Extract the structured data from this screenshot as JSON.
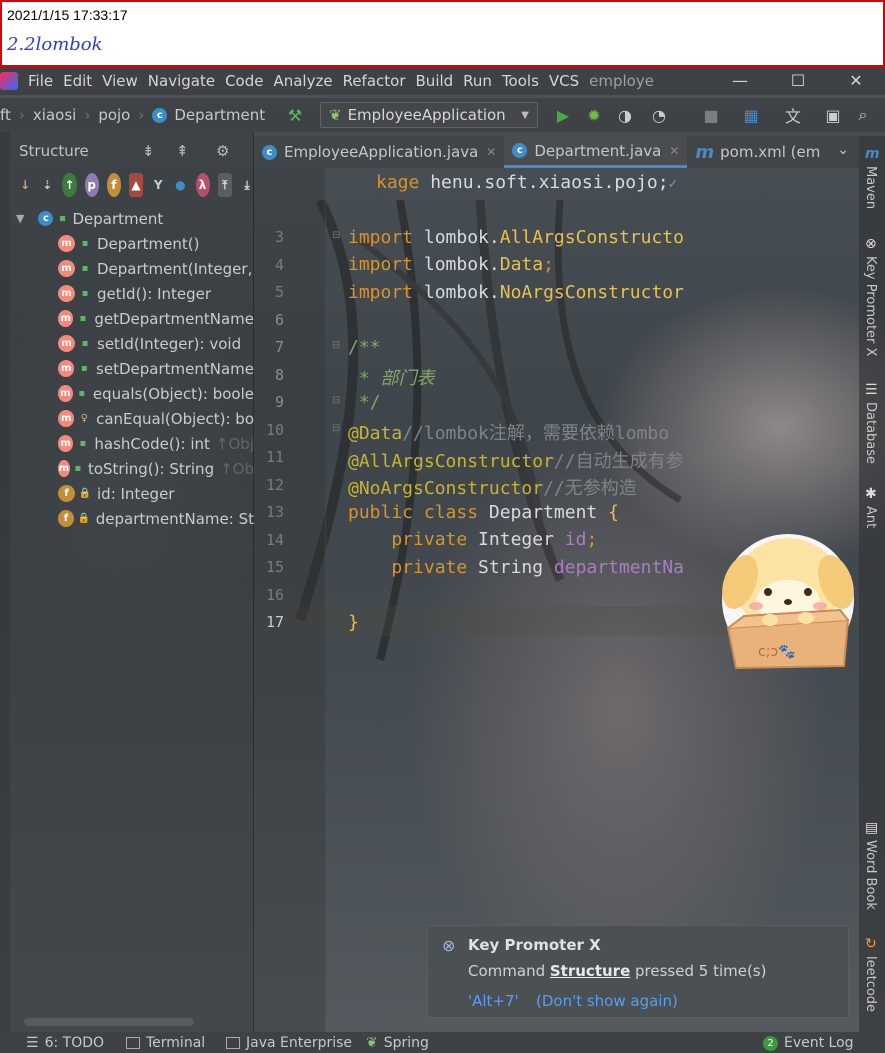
{
  "annotation": {
    "timestamp": "2021/1/15 17:33:17",
    "note_title": "2.2lombok"
  },
  "menu": {
    "items": [
      "File",
      "Edit",
      "View",
      "Navigate",
      "Code",
      "Analyze",
      "Refactor",
      "Build",
      "Run",
      "Tools",
      "VCS"
    ],
    "project_name": "employe",
    "window_buttons": [
      "—",
      "☐",
      "✕"
    ]
  },
  "breadcrumb": {
    "items": [
      "ft",
      "xiaosi",
      "pojo",
      "Department"
    ]
  },
  "run_config": {
    "label": "EmployeeApplication"
  },
  "structure": {
    "title": "Structure",
    "root": "Department",
    "members": [
      {
        "kind": "m",
        "vis": "pub",
        "label": "Department()",
        "hint": ""
      },
      {
        "kind": "m",
        "vis": "pub",
        "label": "Department(Integer,",
        "hint": ""
      },
      {
        "kind": "m",
        "vis": "pub",
        "label": "getId(): Integer",
        "hint": ""
      },
      {
        "kind": "m",
        "vis": "pub",
        "label": "getDepartmentName",
        "hint": ""
      },
      {
        "kind": "m",
        "vis": "pub",
        "label": "setId(Integer): void",
        "hint": ""
      },
      {
        "kind": "m",
        "vis": "pub",
        "label": "setDepartmentName",
        "hint": ""
      },
      {
        "kind": "m",
        "vis": "pub",
        "label": "equals(Object): boole",
        "hint": ""
      },
      {
        "kind": "m",
        "vis": "prot",
        "label": "canEqual(Object): bo",
        "hint": ""
      },
      {
        "kind": "m",
        "vis": "pub",
        "label": "hashCode(): int",
        "hint": "↑Obj"
      },
      {
        "kind": "m",
        "vis": "pub",
        "label": "toString(): String",
        "hint": "↑Ob"
      },
      {
        "kind": "f",
        "vis": "priv",
        "label": "id: Integer",
        "hint": ""
      },
      {
        "kind": "f",
        "vis": "priv",
        "label": "departmentName: St",
        "hint": ""
      }
    ]
  },
  "tabs": [
    {
      "label": "EmployeeApplication.java",
      "active": false
    },
    {
      "label": "Department.java",
      "active": true
    },
    {
      "label": "pom.xml (em",
      "active": false
    }
  ],
  "editor": {
    "visible_line_numbers": [
      "3",
      "4",
      "5",
      "6",
      "7",
      "8",
      "9",
      "10",
      "11",
      "12",
      "13",
      "14",
      "15",
      "16",
      "17"
    ],
    "current_line": "17",
    "lines": {
      "l1_kw": "kage",
      "l1_rest": " henu.soft.xiaosi.pojo;",
      "l3_kw": "import",
      "l3_pkg": " lombok.",
      "l3_cls": "AllArgsConstructo",
      "l4_kw": "import",
      "l4_pkg": " lombok.",
      "l4_cls": "Data",
      "l4_end": ";",
      "l5_kw": "import",
      "l5_pkg": " lombok.",
      "l5_cls": "NoArgsConstructor",
      "l7": "/**",
      "l8": " * 部门表",
      "l9": " */",
      "l10_ann": "@Data",
      "l10_cm": "//lombok注解，需要依赖lombo",
      "l11_ann": "@AllArgsConstructor",
      "l11_cm": "//自动生成有参",
      "l12_ann": "@NoArgsConstructor",
      "l12_cm": "//无参构造",
      "l13_kw": "public class",
      "l13_rest": " Department ",
      "l13_brace": "{",
      "l14_kw": "    private",
      "l14_type": " Integer ",
      "l14_fld": "id",
      "l14_end": ";",
      "l15_kw": "    private",
      "l15_type": " String ",
      "l15_fld": "departmentNa",
      "l17": "}"
    }
  },
  "right_tools": [
    "Maven",
    "Key Promoter X",
    "Database",
    "Ant",
    "Word Book",
    "leetcode"
  ],
  "notification": {
    "title": "Key Promoter X",
    "message_prefix": "Command ",
    "message_command": "Structure",
    "message_suffix": " pressed 5 time(s)",
    "shortcut": "'Alt+7'",
    "dont_show": "(Don't show again)"
  },
  "bottom_bar": {
    "todo": "6: TODO",
    "terminal": "Terminal",
    "java_enterprise": "Java Enterprise",
    "spring": "Spring",
    "event_count": "2",
    "event_log": "Event Log"
  },
  "colors": {
    "keyword": "#d9932c",
    "annotation": "#c9b42a",
    "comment": "#84a36a",
    "field": "#a87ec0",
    "link": "#589df6",
    "note_border": "#e00000",
    "note_title": "#2a3fd0"
  }
}
